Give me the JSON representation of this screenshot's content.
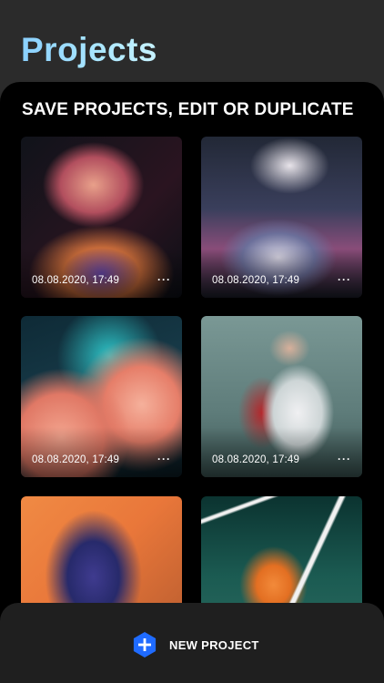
{
  "header": {
    "title": "Projects"
  },
  "sheet": {
    "subtitle": "SAVE PROJECTS, EDIT OR DUPLICATE"
  },
  "projects": [
    {
      "date": "08.08.2020, 17:49",
      "more": "···"
    },
    {
      "date": "08.08.2020, 17:49",
      "more": "···"
    },
    {
      "date": "08.08.2020, 17:49",
      "more": "···"
    },
    {
      "date": "08.08.2020, 17:49",
      "more": "···"
    },
    {
      "date": "",
      "more": ""
    },
    {
      "date": "",
      "more": ""
    }
  ],
  "bottom_bar": {
    "new_project_label": "NEW PROJECT",
    "icon": "plus-hexagon-icon",
    "accent": "#1f6bff"
  }
}
